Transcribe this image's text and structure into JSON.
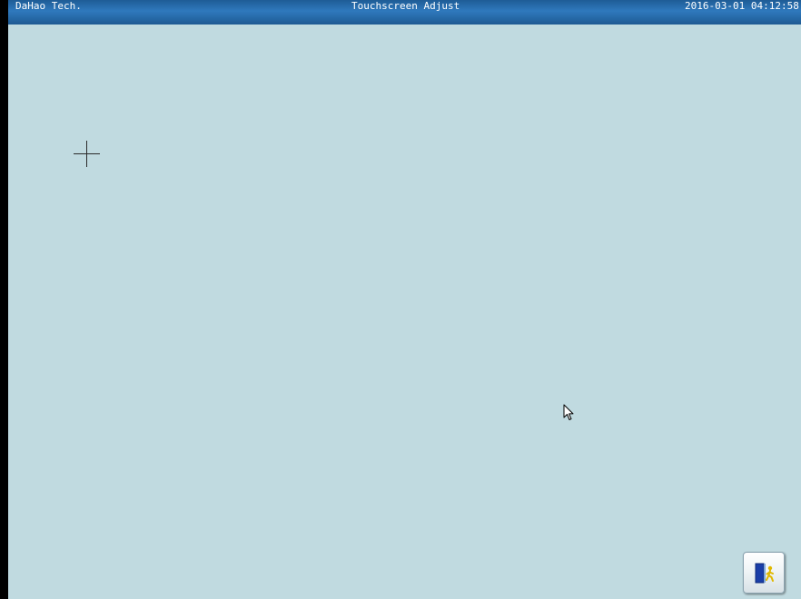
{
  "header": {
    "brand": "DaHao Tech.",
    "title": "Touchscreen Adjust",
    "datetime": "2016-03-01 04:12:58"
  },
  "calibration": {
    "target_icon": "crosshair-icon"
  },
  "cursor": {
    "icon": "mouse-pointer-icon"
  },
  "exit_button": {
    "icon": "exit-door-icon"
  },
  "colors": {
    "background": "#c0dae0",
    "title_bar": "#2f79bd",
    "title_text": "#ffffff",
    "door": "#1a3ea8",
    "figure": "#e0b800"
  }
}
